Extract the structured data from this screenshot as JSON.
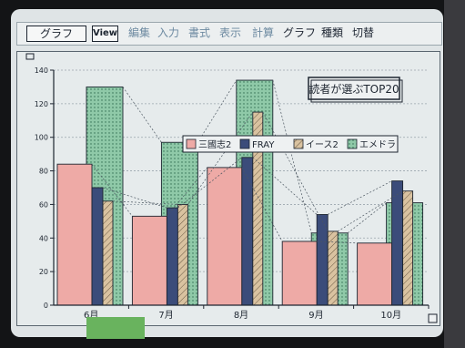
{
  "menubar": {
    "app_menu": "グラフ",
    "view_menu": "View",
    "items": [
      {
        "label": "編集",
        "dim": true
      },
      {
        "label": "入力",
        "dim": true
      },
      {
        "label": "書式",
        "dim": true
      },
      {
        "label": "表示",
        "dim": true
      },
      {
        "label": "計算",
        "dim": true
      },
      {
        "label": "グラフ",
        "dim": false
      },
      {
        "label": "種類",
        "dim": false
      },
      {
        "label": "切替",
        "dim": false
      }
    ]
  },
  "colors": {
    "series_pink": "#eeaaa6",
    "series_navy": "#3b4c7a",
    "series_tan": "#d9c2a0",
    "series_green": "#8fc9a8",
    "grid": "#7f8a93"
  },
  "chart_data": {
    "type": "bar",
    "title": "読者が選ぶTOP20",
    "categories": [
      "6月",
      "7月",
      "8月",
      "9月",
      "10月"
    ],
    "series": [
      {
        "name": "三國志2",
        "values": [
          84,
          53,
          82,
          38,
          37
        ]
      },
      {
        "name": "FRAY",
        "values": [
          70,
          58,
          88,
          54,
          74
        ]
      },
      {
        "name": "イース2",
        "values": [
          62,
          60,
          115,
          44,
          68
        ]
      },
      {
        "name": "エメドラ",
        "values": [
          130,
          97,
          134,
          43,
          61
        ]
      }
    ],
    "ylim": [
      0,
      140
    ],
    "yticks": [
      0,
      20,
      40,
      60,
      80,
      100,
      120,
      140
    ],
    "grid": true,
    "legend": "center"
  }
}
